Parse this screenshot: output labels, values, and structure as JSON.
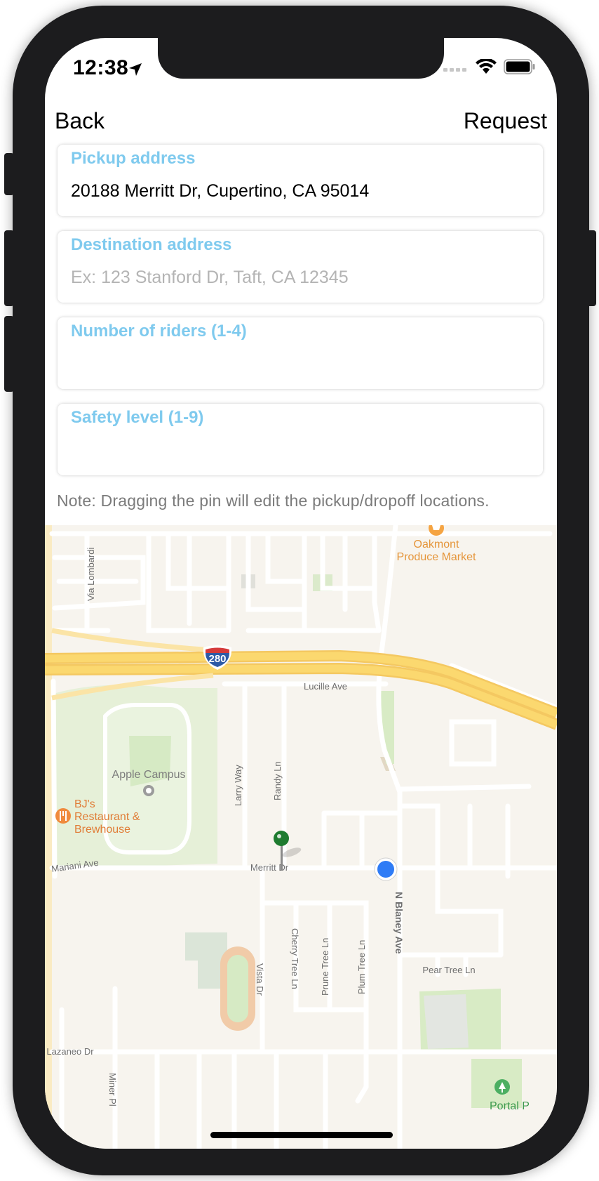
{
  "status_bar": {
    "time": "12:38"
  },
  "nav": {
    "back_label": "Back",
    "request_label": "Request"
  },
  "form": {
    "pickup": {
      "label": "Pickup address",
      "value": "20188 Merritt Dr, Cupertino, CA 95014"
    },
    "destination": {
      "label": "Destination address",
      "placeholder": "Ex: 123 Stanford Dr, Taft, CA 12345"
    },
    "riders": {
      "label": "Number of riders (1-4)",
      "value": ""
    },
    "safety": {
      "label": "Safety level (1-9)",
      "value": ""
    }
  },
  "note": "Note: Dragging the pin will edit the pickup/dropoff locations.",
  "map": {
    "poi": {
      "oakmont_line1": "Oakmont",
      "oakmont_line2": "Produce Market",
      "apple_campus": "Apple Campus",
      "bjs_line1": "BJ's",
      "bjs_line2": "Restaurant &",
      "bjs_line3": "Brewhouse",
      "portal": "Portal P"
    },
    "highway_shield": "280",
    "streets": {
      "via_lombardi": "Via Lombardi",
      "lucille": "Lucille Ave",
      "larry": "Larry Way",
      "randy": "Randy Ln",
      "mariani": "Mariani Ave",
      "merritt": "Merritt Dr",
      "n_blaney": "N Blaney Ave",
      "cherry_tree": "Cherry Tree Ln",
      "prune_tree": "Prune Tree Ln",
      "plum_tree": "Plum Tree Ln",
      "vista": "Vista Dr",
      "pear_tree": "Pear Tree Ln",
      "lazaneo": "Lazaneo Dr",
      "miner": "Miner Pl"
    },
    "colors": {
      "land": "#f7f4ee",
      "road": "#ffffff",
      "highway": "#fbd86f",
      "park": "#d9ecc7",
      "pin": "#1e7b2f",
      "user_location": "#2f7cf6"
    }
  }
}
